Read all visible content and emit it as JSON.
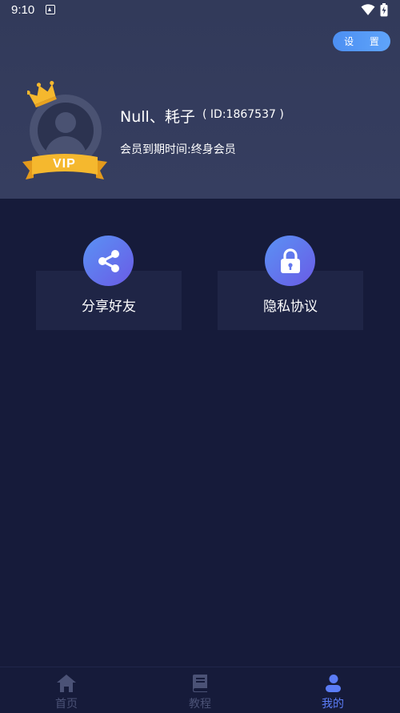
{
  "status_bar": {
    "time": "9:10"
  },
  "header": {
    "settings_label": "设 置",
    "vip_badge": "VIP",
    "username": "Null、耗子",
    "user_id": "( ID:1867537 )",
    "member_expiry": "会员到期时间:终身会员"
  },
  "actions": [
    {
      "label": "分享好友",
      "icon": "share-icon"
    },
    {
      "label": "隐私协议",
      "icon": "lock-icon"
    }
  ],
  "tabbar": {
    "tabs": [
      {
        "label": "首页",
        "icon": "home-icon",
        "active": false
      },
      {
        "label": "教程",
        "icon": "book-icon",
        "active": false
      },
      {
        "label": "我的",
        "icon": "user-icon",
        "active": true
      }
    ]
  },
  "colors": {
    "background": "#161b3a",
    "header": "#343c5d",
    "card": "#1f2546",
    "accent": "#5b7cf6",
    "inactive_tab": "#4b5276",
    "vip_gold": "#f5b82e"
  }
}
